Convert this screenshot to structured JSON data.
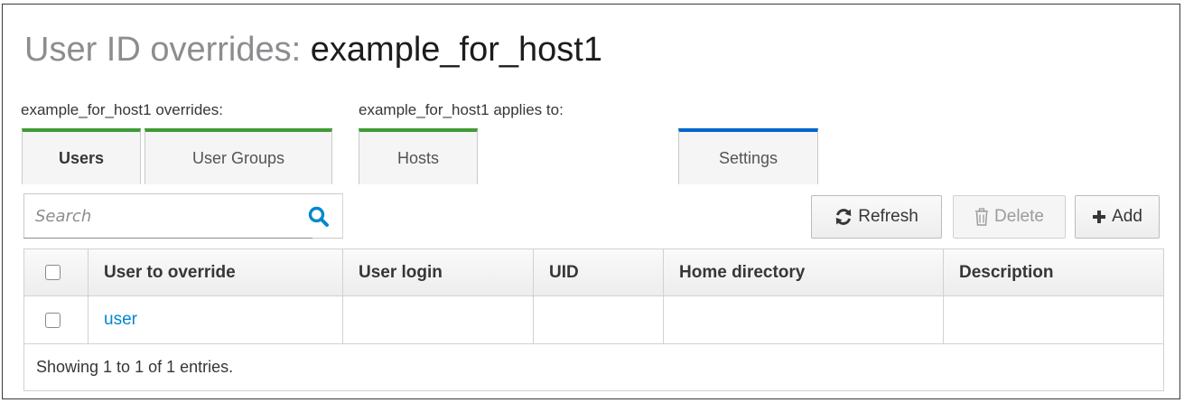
{
  "header": {
    "title_prefix": "User ID overrides:",
    "title_name": "example_for_host1"
  },
  "sections": {
    "overrides_label": "example_for_host1 overrides:",
    "applies_to_label": "example_for_host1 applies to:"
  },
  "tabs": [
    {
      "label": "Users",
      "active": true
    },
    {
      "label": "User Groups",
      "active": false
    },
    {
      "label": "Hosts",
      "active": false
    },
    {
      "label": "Settings",
      "active": false
    }
  ],
  "colors": {
    "tab_green": "#3f9c35",
    "tab_blue": "#0066cc",
    "link": "#0088ce",
    "search_icon": "#0088ce"
  },
  "toolbar": {
    "search_placeholder": "Search",
    "search_icon": "search-icon",
    "refresh": {
      "label": "Refresh",
      "icon": "refresh-icon"
    },
    "delete": {
      "label": "Delete",
      "icon": "trash-icon",
      "disabled": true
    },
    "add": {
      "label": "Add",
      "icon": "plus-icon"
    }
  },
  "table": {
    "columns": [
      "User to override",
      "User login",
      "UID",
      "Home directory",
      "Description"
    ],
    "rows": [
      {
        "user_to_override": "user",
        "user_login": "",
        "uid": "",
        "home_directory": "",
        "description": ""
      }
    ],
    "footer": "Showing 1 to 1 of 1 entries."
  }
}
